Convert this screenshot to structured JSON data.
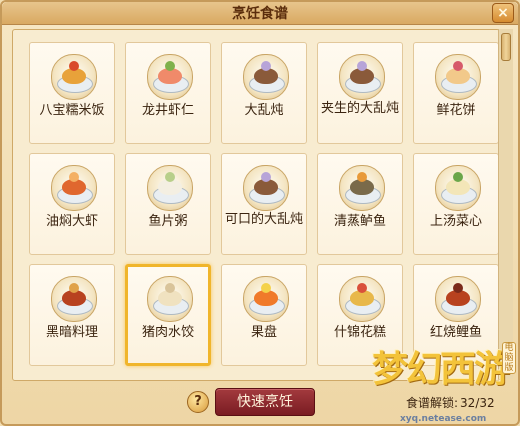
{
  "window": {
    "title": "烹饪食谱",
    "close_label": "×"
  },
  "recipes": [
    {
      "name": "八宝糯米饭",
      "icon": "eight-treasure-rice-icon",
      "color": "#e8a23a",
      "accent": "#d94a2b"
    },
    {
      "name": "龙井虾仁",
      "icon": "longjing-shrimp-icon",
      "color": "#f08a6a",
      "accent": "#7fb14c"
    },
    {
      "name": "大乱炖",
      "icon": "stew-icon",
      "color": "#8a5a3a",
      "accent": "#b7a4d8"
    },
    {
      "name": "夹生的大乱炖",
      "icon": "undercooked-stew-icon",
      "color": "#8a5a3a",
      "accent": "#b7a4d8"
    },
    {
      "name": "鲜花饼",
      "icon": "flower-cake-icon",
      "color": "#f2c98a",
      "accent": "#d65a6a"
    },
    {
      "name": "油焖大虾",
      "icon": "braised-prawn-icon",
      "color": "#e0672e",
      "accent": "#f4b063"
    },
    {
      "name": "鱼片粥",
      "icon": "fish-porridge-icon",
      "color": "#f4efe2",
      "accent": "#b8cf8a"
    },
    {
      "name": "可口的大乱炖",
      "icon": "tasty-stew-icon",
      "color": "#8a5a3a",
      "accent": "#b7a4d8"
    },
    {
      "name": "清蒸鲈鱼",
      "icon": "steamed-perch-icon",
      "color": "#7a6a4a",
      "accent": "#e89a3a"
    },
    {
      "name": "上汤菜心",
      "icon": "vegetable-soup-icon",
      "color": "#f3e6b8",
      "accent": "#6aa64a"
    },
    {
      "name": "黑暗料理",
      "icon": "dark-cuisine-icon",
      "color": "#b8421f",
      "accent": "#e0a24a"
    },
    {
      "name": "猪肉水饺",
      "icon": "pork-dumpling-icon",
      "color": "#f0e2c0",
      "accent": "#d9c49a",
      "selected": true
    },
    {
      "name": "果盘",
      "icon": "fruit-plate-icon",
      "color": "#f07a2a",
      "accent": "#f4d24a"
    },
    {
      "name": "什锦花糕",
      "icon": "assorted-cake-icon",
      "color": "#e8b84a",
      "accent": "#d9503a"
    },
    {
      "name": "红烧鲤鱼",
      "icon": "braised-carp-icon",
      "color": "#b8421f",
      "accent": "#7a2a1a"
    }
  ],
  "footer": {
    "help_label": "?",
    "cook_button_label": "快速烹饪",
    "unlock_label": "食谱解锁:",
    "unlock_count": "32/32"
  },
  "logo": {
    "text": "梦幻西游",
    "sub": "电脑版",
    "url": "xyq.netease.com"
  }
}
